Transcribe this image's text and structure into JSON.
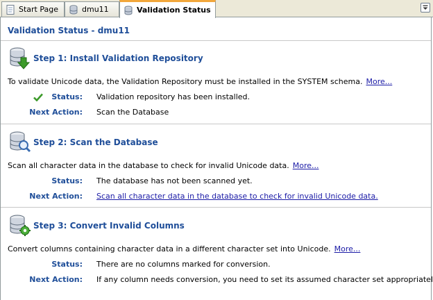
{
  "tabs": [
    {
      "label": "Start Page",
      "icon": "document-icon",
      "active": false
    },
    {
      "label": "dmu11",
      "icon": "database-icon",
      "active": false
    },
    {
      "label": "Validation Status",
      "icon": "database-icon",
      "active": true
    }
  ],
  "page_title": "Validation Status - dmu11",
  "steps": [
    {
      "title": "Step 1: Install Validation Repository",
      "icon": "database-install-icon",
      "description": "To validate Unicode data, the Validation Repository must be installed in the SYSTEM schema.",
      "more": "More...",
      "status_label": "Status:",
      "status_value": "Validation repository has been installed.",
      "status_icon": "check-icon",
      "action_label": "Next Action:",
      "action_value": "Scan the Database"
    },
    {
      "title": "Step 2: Scan the Database",
      "icon": "database-scan-icon",
      "description": "Scan all character data in the database to check for invalid Unicode data.",
      "more": "More...",
      "status_label": "Status:",
      "status_value": "The database has not been scanned yet.",
      "action_label": "Next Action:",
      "action_value": "Scan all character data in the database to check for invalid Unicode data."
    },
    {
      "title": "Step 3: Convert Invalid Columns",
      "icon": "database-convert-icon",
      "description": "Convert columns containing character data in a different character set into Unicode.",
      "more": "More...",
      "status_label": "Status:",
      "status_value": "There are no columns marked for conversion.",
      "action_label": "Next Action:",
      "action_value": "If any column needs conversion, you need to set its assumed character set appropriately."
    }
  ],
  "colors": {
    "heading": "#1f4e99",
    "link": "#1a1aa6",
    "active_tab_accent": "#f2a73b",
    "check": "#3c9a2a"
  }
}
